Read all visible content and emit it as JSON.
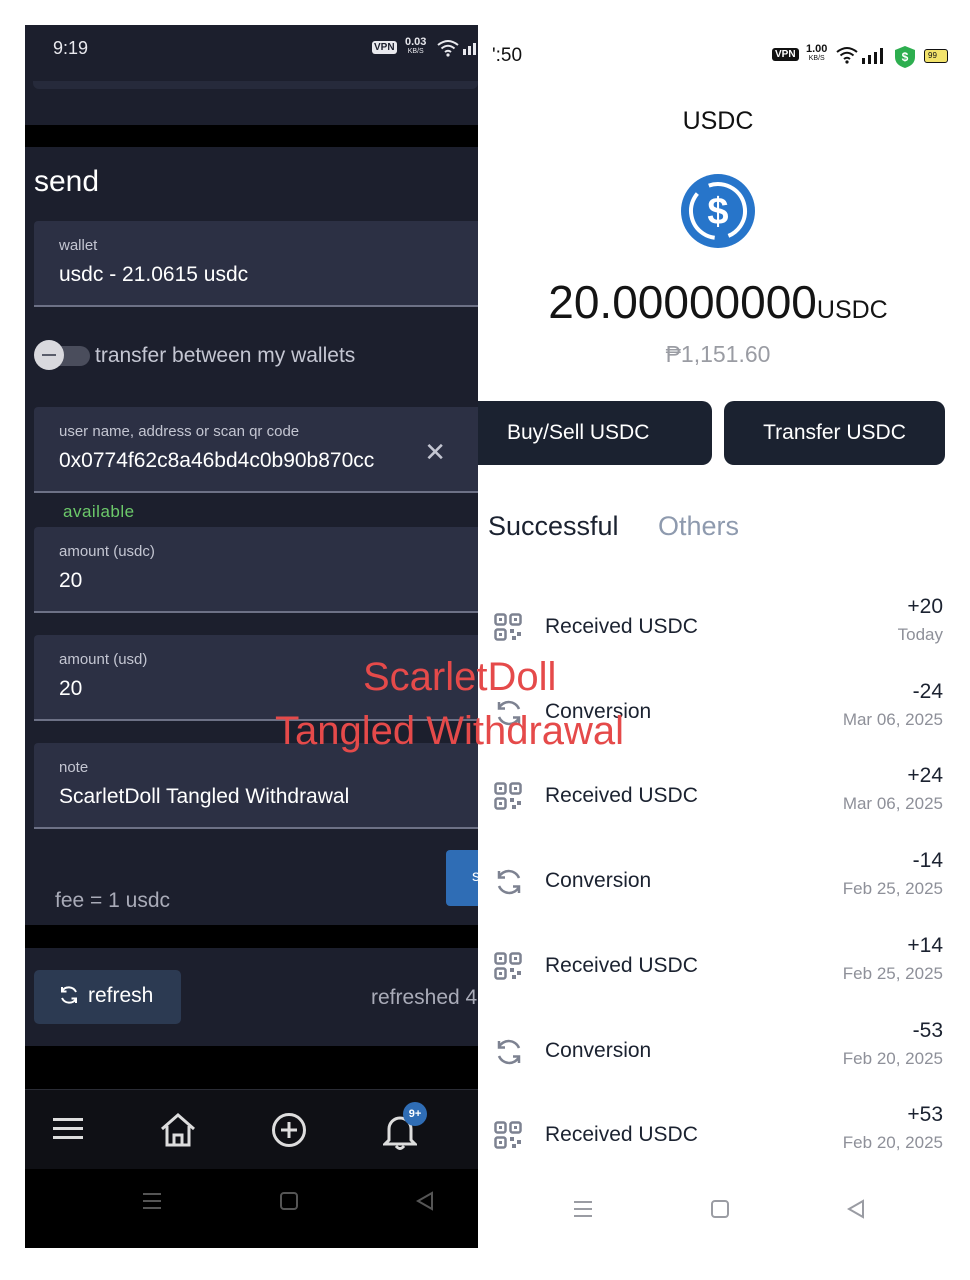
{
  "left_phone": {
    "status_bar": {
      "time": "9:19",
      "vpn": "VPN",
      "speed_value": "0.03",
      "speed_unit": "KB/S"
    },
    "title": "send",
    "wallet_field": {
      "label": "wallet",
      "value": "usdc - 21.0615 usdc"
    },
    "transfer_toggle": {
      "label": "transfer between my wallets",
      "on": false
    },
    "recipient_field": {
      "label": "user name, address or scan qr code",
      "value": "0x0774f62c8a46bd4c0b90b870cc"
    },
    "available_label": "available",
    "amount_usdc_field": {
      "label": "amount (usdc)",
      "value": "20"
    },
    "amount_usd_field": {
      "label": "amount (usd)",
      "value": "20"
    },
    "note_field": {
      "label": "note",
      "value": "ScarletDoll Tangled Withdrawal"
    },
    "fee": "fee = 1 usdc",
    "send_button_label": "s",
    "refresh_button_label": "refresh",
    "refreshed_text": "refreshed 4",
    "bottom_nav": {
      "icons": [
        "menu-icon",
        "home-icon",
        "add-circle-icon",
        "bell-icon"
      ],
      "notification_badge": "9+"
    },
    "accent_color": "#2f6db5",
    "available_color": "#6cc96a"
  },
  "right_phone": {
    "status_bar": {
      "time": "':50",
      "vpn": "VPN",
      "speed_value": "1.00",
      "speed_unit": "KB/S",
      "battery": "99"
    },
    "title": "USDC",
    "balance_amount": "20.00000000",
    "balance_unit": "USDC",
    "fiat_value": "₱1,151.60",
    "buy_sell_button": "Buy/Sell USDC",
    "transfer_button": "Transfer USDC",
    "tabs": [
      {
        "label": "Successful",
        "active": true
      },
      {
        "label": "Others",
        "active": false
      }
    ],
    "transactions": [
      {
        "icon": "qr-code-icon",
        "name": "Received USDC",
        "amount": "+20",
        "date": "Today"
      },
      {
        "icon": "conversion-icon",
        "name": "Conversion",
        "amount": "-24",
        "date": "Mar 06, 2025"
      },
      {
        "icon": "qr-code-icon",
        "name": "Received USDC",
        "amount": "+24",
        "date": "Mar 06, 2025"
      },
      {
        "icon": "conversion-icon",
        "name": "Conversion",
        "amount": "-14",
        "date": "Feb 25, 2025"
      },
      {
        "icon": "qr-code-icon",
        "name": "Received USDC",
        "amount": "+14",
        "date": "Feb 25, 2025"
      },
      {
        "icon": "conversion-icon",
        "name": "Conversion",
        "amount": "-53",
        "date": "Feb 20, 2025"
      },
      {
        "icon": "qr-code-icon",
        "name": "Received USDC",
        "amount": "+53",
        "date": "Feb 20, 2025"
      }
    ],
    "coin_color": "#2775ca"
  },
  "watermark": {
    "line1": "ScarletDoll",
    "line2": "Tangled Withdrawal",
    "color": "#e54a4a"
  }
}
